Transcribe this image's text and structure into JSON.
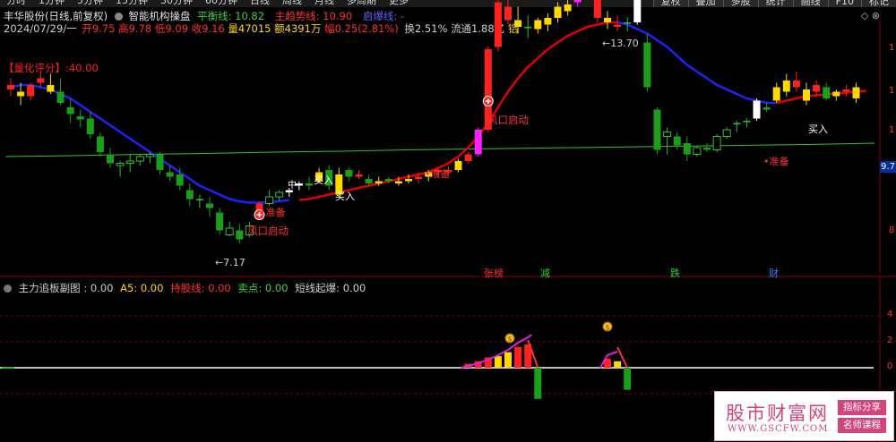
{
  "toolbar": {
    "periods": [
      "分时",
      "1分钟",
      "5分钟",
      "15分钟",
      "30分钟",
      "60分钟",
      "日线",
      "周线",
      "月线",
      "多周期",
      "更多"
    ],
    "right_buttons": [
      "复权",
      "叠加",
      "多股",
      "统计",
      "画线",
      "F10",
      "标记"
    ]
  },
  "header": {
    "stock": "丰华股份(日线,前复权)",
    "indicator": "智能机构操盘",
    "balance_label": "平衡线: 10.82",
    "trend_label": "主趋势线: 10.90",
    "break_label": "启爆线: -",
    "date": "2024/07/29/一",
    "open": "开9.75",
    "high": "高9.78",
    "low": "低9.09",
    "close": "收9.16",
    "volume": "量47015",
    "amount": "额4391万",
    "change": "幅0.25(2.81%)",
    "turnover": "换2.51%",
    "float": "流通1.88亿",
    "tag": "铝"
  },
  "window_controls": "◇ ⊗",
  "score_label": "【量化评分】:40.00",
  "price_axis": {
    "current": "9.7"
  },
  "annotations": {
    "high_price": "13.70",
    "low_price": "7.17",
    "wind_start": "风口启动",
    "prepare": "准备",
    "buy": "买入",
    "zhong": "中"
  },
  "events": [
    "张榜",
    "减",
    "跌",
    "财"
  ],
  "sub_panel": {
    "name": "主力追板副图",
    "value": ": 0.00",
    "a5": "A5: 0.00",
    "hold": "持股线: 0.00",
    "sell": "卖点: 0.00",
    "short": "短线起爆: 0.00",
    "axis": [
      "4",
      "2",
      "0"
    ]
  },
  "watermark": {
    "title": "股市财富网",
    "site": "WWW.GSCFW.COM",
    "tag1": "指标分享",
    "tag2": "名师课程"
  },
  "colors": {
    "up": "#ff2020",
    "down": "#1a9f1a",
    "yellow": "#ffd800",
    "blue_line": "#2020ff",
    "red_line": "#e00000",
    "green_line": "#30c030"
  },
  "chart_data": {
    "type": "candlestick",
    "title": "",
    "y_range_visible": [
      7.0,
      14.2
    ],
    "candles": [
      {
        "o": 10.55,
        "h": 10.7,
        "l": 10.3,
        "c": 10.45,
        "k": "red"
      },
      {
        "o": 10.4,
        "h": 10.6,
        "l": 10.1,
        "c": 10.3,
        "k": "yellow"
      },
      {
        "o": 10.3,
        "h": 10.6,
        "l": 10.2,
        "c": 10.55,
        "k": "red"
      },
      {
        "o": 10.7,
        "h": 10.85,
        "l": 10.5,
        "c": 10.6,
        "k": "red"
      },
      {
        "o": 10.55,
        "h": 10.8,
        "l": 10.35,
        "c": 10.4,
        "k": "yellow"
      },
      {
        "o": 10.4,
        "h": 10.7,
        "l": 10.1,
        "c": 10.15,
        "k": "green"
      },
      {
        "o": 10.05,
        "h": 10.25,
        "l": 9.7,
        "c": 9.9,
        "k": "green"
      },
      {
        "o": 9.85,
        "h": 10.0,
        "l": 9.6,
        "c": 9.78,
        "k": "green"
      },
      {
        "o": 9.8,
        "h": 9.95,
        "l": 9.35,
        "c": 9.45,
        "k": "green"
      },
      {
        "o": 9.4,
        "h": 9.5,
        "l": 8.95,
        "c": 9.05,
        "k": "green"
      },
      {
        "o": 9.0,
        "h": 9.15,
        "l": 8.7,
        "c": 8.8,
        "k": "green"
      },
      {
        "o": 8.75,
        "h": 8.85,
        "l": 8.5,
        "c": 8.8,
        "k": "hollow"
      },
      {
        "o": 8.8,
        "h": 9.0,
        "l": 8.6,
        "c": 8.85,
        "k": "hollow"
      },
      {
        "o": 8.85,
        "h": 9.0,
        "l": 8.75,
        "c": 8.95,
        "k": "hollow"
      },
      {
        "o": 8.95,
        "h": 9.05,
        "l": 8.8,
        "c": 9.0,
        "k": "hollow"
      },
      {
        "o": 9.0,
        "h": 9.05,
        "l": 8.55,
        "c": 8.65,
        "k": "green"
      },
      {
        "o": 8.6,
        "h": 8.75,
        "l": 8.4,
        "c": 8.5,
        "k": "green"
      },
      {
        "o": 8.55,
        "h": 8.7,
        "l": 8.2,
        "c": 8.3,
        "k": "green"
      },
      {
        "o": 8.2,
        "h": 8.35,
        "l": 7.85,
        "c": 8.0,
        "k": "green"
      },
      {
        "o": 8.0,
        "h": 8.1,
        "l": 7.8,
        "c": 7.95,
        "k": "doji"
      },
      {
        "o": 7.9,
        "h": 8.05,
        "l": 7.6,
        "c": 7.8,
        "k": "green"
      },
      {
        "o": 7.7,
        "h": 7.8,
        "l": 7.2,
        "c": 7.3,
        "k": "green"
      },
      {
        "o": 7.2,
        "h": 7.5,
        "l": 7.17,
        "c": 7.35,
        "k": "hollow"
      },
      {
        "o": 7.3,
        "h": 7.45,
        "l": 7.0,
        "c": 7.1,
        "k": "green"
      },
      {
        "o": 7.2,
        "h": 7.5,
        "l": 7.15,
        "c": 7.4,
        "k": "hollow"
      },
      {
        "o": 7.75,
        "h": 7.95,
        "l": 7.7,
        "c": 7.9,
        "k": "red"
      },
      {
        "o": 7.9,
        "h": 8.2,
        "l": 7.85,
        "c": 8.05,
        "k": "hollow"
      },
      {
        "o": 8.05,
        "h": 8.2,
        "l": 7.95,
        "c": 8.15,
        "k": "hollow"
      },
      {
        "o": 8.15,
        "h": 8.25,
        "l": 8.05,
        "c": 8.2,
        "k": "white"
      },
      {
        "o": 8.3,
        "h": 8.4,
        "l": 8.2,
        "c": 8.35,
        "k": "white"
      },
      {
        "o": 8.35,
        "h": 8.5,
        "l": 8.2,
        "c": 8.3,
        "k": "green"
      },
      {
        "o": 8.4,
        "h": 8.7,
        "l": 8.35,
        "c": 8.6,
        "k": "yellow"
      },
      {
        "o": 8.65,
        "h": 8.75,
        "l": 8.2,
        "c": 8.3,
        "k": "green"
      },
      {
        "o": 8.55,
        "h": 8.7,
        "l": 8.05,
        "c": 8.1,
        "k": "yellow"
      },
      {
        "o": 8.5,
        "h": 8.7,
        "l": 8.4,
        "c": 8.65,
        "k": "green"
      },
      {
        "o": 8.55,
        "h": 8.65,
        "l": 8.45,
        "c": 8.5,
        "k": "red"
      },
      {
        "o": 8.45,
        "h": 8.55,
        "l": 8.3,
        "c": 8.35,
        "k": "green"
      },
      {
        "o": 8.4,
        "h": 8.5,
        "l": 8.3,
        "c": 8.35,
        "k": "yellow"
      },
      {
        "o": 8.4,
        "h": 8.5,
        "l": 8.35,
        "c": 8.45,
        "k": "green"
      },
      {
        "o": 8.4,
        "h": 8.5,
        "l": 8.3,
        "c": 8.35,
        "k": "yellow"
      },
      {
        "o": 8.4,
        "h": 8.55,
        "l": 8.35,
        "c": 8.45,
        "k": "yellow"
      },
      {
        "o": 8.45,
        "h": 8.6,
        "l": 8.35,
        "c": 8.5,
        "k": "red"
      },
      {
        "o": 8.5,
        "h": 8.65,
        "l": 8.4,
        "c": 8.6,
        "k": "yellow"
      },
      {
        "o": 8.6,
        "h": 8.7,
        "l": 8.5,
        "c": 8.65,
        "k": "red"
      },
      {
        "o": 8.65,
        "h": 8.75,
        "l": 8.55,
        "c": 8.6,
        "k": "red"
      },
      {
        "o": 8.65,
        "h": 8.9,
        "l": 8.6,
        "c": 8.85,
        "k": "yellow"
      },
      {
        "o": 8.85,
        "h": 9.05,
        "l": 8.8,
        "c": 9.0,
        "k": "red"
      },
      {
        "o": 9.0,
        "h": 9.6,
        "l": 8.95,
        "c": 9.55,
        "k": "magenta"
      },
      {
        "o": 9.55,
        "h": 11.4,
        "l": 9.5,
        "c": 11.35,
        "k": "red"
      },
      {
        "o": 11.4,
        "h": 12.7,
        "l": 11.3,
        "c": 12.4,
        "k": "red"
      },
      {
        "o": 12.3,
        "h": 12.5,
        "l": 11.9,
        "c": 12.0,
        "k": "red"
      },
      {
        "o": 12.0,
        "h": 12.3,
        "l": 11.7,
        "c": 11.85,
        "k": "yellow"
      },
      {
        "o": 11.85,
        "h": 12.1,
        "l": 11.6,
        "c": 11.8,
        "k": "doji"
      },
      {
        "o": 11.8,
        "h": 12.05,
        "l": 11.7,
        "c": 12.0,
        "k": "yellow"
      },
      {
        "o": 11.9,
        "h": 12.15,
        "l": 11.75,
        "c": 12.05,
        "k": "yellow"
      },
      {
        "o": 12.05,
        "h": 12.4,
        "l": 11.95,
        "c": 12.3,
        "k": "yellow"
      },
      {
        "o": 12.2,
        "h": 12.45,
        "l": 12.1,
        "c": 12.35,
        "k": "yellow"
      },
      {
        "o": 12.4,
        "h": 12.6,
        "l": 12.3,
        "c": 12.5,
        "k": "magenta"
      },
      {
        "o": 12.55,
        "h": 13.7,
        "l": 12.5,
        "c": 12.95,
        "k": "red"
      },
      {
        "o": 12.95,
        "h": 13.2,
        "l": 11.95,
        "c": 12.05,
        "k": "red"
      },
      {
        "o": 12.05,
        "h": 12.2,
        "l": 11.8,
        "c": 11.95,
        "k": "yellow"
      },
      {
        "o": 11.9,
        "h": 12.1,
        "l": 11.75,
        "c": 11.85,
        "k": "red"
      },
      {
        "o": 11.85,
        "h": 12.05,
        "l": 11.75,
        "c": 11.95,
        "k": "doji"
      },
      {
        "o": 11.95,
        "h": 12.7,
        "l": 11.9,
        "c": 12.6,
        "k": "white"
      },
      {
        "o": 11.5,
        "h": 11.7,
        "l": 10.4,
        "c": 10.5,
        "k": "green"
      },
      {
        "o": 10.0,
        "h": 10.05,
        "l": 9.0,
        "c": 9.1,
        "k": "green"
      },
      {
        "o": 9.4,
        "h": 9.6,
        "l": 9.0,
        "c": 9.5,
        "k": "hollow"
      },
      {
        "o": 9.4,
        "h": 9.5,
        "l": 9.1,
        "c": 9.2,
        "k": "green"
      },
      {
        "o": 9.25,
        "h": 9.4,
        "l": 8.85,
        "c": 9.0,
        "k": "green"
      },
      {
        "o": 9.0,
        "h": 9.2,
        "l": 8.95,
        "c": 9.15,
        "k": "hollow"
      },
      {
        "o": 9.15,
        "h": 9.25,
        "l": 9.05,
        "c": 9.1,
        "k": "green"
      },
      {
        "o": 9.1,
        "h": 9.45,
        "l": 9.05,
        "c": 9.4,
        "k": "hollow"
      },
      {
        "o": 9.4,
        "h": 9.6,
        "l": 9.35,
        "c": 9.55,
        "k": "hollow"
      },
      {
        "o": 9.6,
        "h": 9.75,
        "l": 9.5,
        "c": 9.7,
        "k": "doji"
      },
      {
        "o": 9.7,
        "h": 9.8,
        "l": 9.6,
        "c": 9.75,
        "k": "doji"
      },
      {
        "o": 9.8,
        "h": 10.25,
        "l": 9.75,
        "c": 10.2,
        "k": "white"
      },
      {
        "o": 10.0,
        "h": 10.15,
        "l": 9.95,
        "c": 10.05,
        "k": "green"
      },
      {
        "o": 10.2,
        "h": 10.6,
        "l": 10.15,
        "c": 10.5,
        "k": "yellow"
      },
      {
        "o": 10.4,
        "h": 10.8,
        "l": 10.3,
        "c": 10.65,
        "k": "yellow"
      },
      {
        "o": 10.65,
        "h": 10.85,
        "l": 10.4,
        "c": 10.5,
        "k": "red"
      },
      {
        "o": 10.45,
        "h": 10.6,
        "l": 10.1,
        "c": 10.2,
        "k": "yellow"
      },
      {
        "o": 10.4,
        "h": 10.65,
        "l": 10.3,
        "c": 10.55,
        "k": "red"
      },
      {
        "o": 10.5,
        "h": 10.6,
        "l": 10.2,
        "c": 10.25,
        "k": "green"
      },
      {
        "o": 10.3,
        "h": 10.45,
        "l": 10.2,
        "c": 10.4,
        "k": "yellow"
      },
      {
        "o": 10.4,
        "h": 10.55,
        "l": 10.3,
        "c": 10.45,
        "k": "red"
      },
      {
        "o": 10.25,
        "h": 10.6,
        "l": 10.15,
        "c": 10.5,
        "k": "yellow"
      }
    ],
    "ma_blue": [
      10.5,
      10.55,
      10.55,
      10.5,
      10.45,
      10.35,
      10.25,
      10.1,
      9.95,
      9.8,
      9.65,
      9.5,
      9.35,
      9.2,
      9.05,
      8.9,
      8.75,
      8.6,
      8.45,
      8.3,
      8.2,
      8.1,
      8.0,
      7.95,
      7.92,
      7.92,
      7.93,
      7.95,
      7.98
    ],
    "ma_red_start": 29,
    "ma_red": [
      7.98,
      8.0,
      8.05,
      8.1,
      8.15,
      8.2,
      8.25,
      8.3,
      8.35,
      8.4,
      8.45,
      8.5,
      8.55,
      8.6,
      8.7,
      8.8,
      8.95,
      9.15,
      9.4,
      9.7,
      10.05,
      10.4,
      10.7,
      10.95,
      11.15,
      11.35,
      11.5,
      11.65,
      11.75,
      11.85,
      11.9,
      11.95,
      11.95
    ],
    "ma_blue2_start": 61,
    "ma_blue2": [
      11.95,
      11.9,
      11.8,
      11.7,
      11.55,
      11.4,
      11.2,
      11.0,
      10.85,
      10.7,
      10.55,
      10.45,
      10.35,
      10.25,
      10.2,
      10.15,
      10.15
    ],
    "ma_red2_start": 77,
    "ma_red2": [
      10.15,
      10.2,
      10.25,
      10.3,
      10.32,
      10.34,
      10.36,
      10.38,
      10.4,
      10.42
    ],
    "green_line": [
      8.95,
      8.97,
      9.0,
      9.02,
      9.05,
      9.07,
      9.1,
      9.12,
      9.14,
      9.16,
      9.18,
      9.2,
      9.22,
      9.25
    ],
    "sub_bars": [
      {
        "i": 46,
        "v": 0.3,
        "k": "red"
      },
      {
        "i": 47,
        "v": 0.5,
        "k": "red"
      },
      {
        "i": 48,
        "v": 0.8,
        "k": "red"
      },
      {
        "i": 49,
        "v": 0.9,
        "k": "yellow"
      },
      {
        "i": 50,
        "v": 1.2,
        "k": "yellow"
      },
      {
        "i": 51,
        "v": 1.6,
        "k": "red"
      },
      {
        "i": 52,
        "v": 1.8,
        "k": "red"
      },
      {
        "i": 53,
        "v": -2.4,
        "k": "green"
      },
      {
        "i": 60,
        "v": 0.7,
        "k": "red"
      },
      {
        "i": 61,
        "v": 0.5,
        "k": "yellow"
      },
      {
        "i": 62,
        "v": -1.7,
        "k": "green"
      }
    ]
  }
}
